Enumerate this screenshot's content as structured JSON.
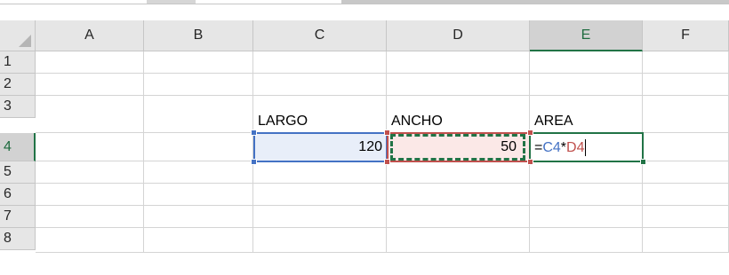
{
  "columns": [
    "A",
    "B",
    "C",
    "D",
    "E",
    "F"
  ],
  "rows": [
    "1",
    "2",
    "3",
    "4",
    "5",
    "6",
    "7",
    "8"
  ],
  "cells": {
    "C3": "LARGO",
    "D3": "ANCHO",
    "E3": "AREA",
    "C4": "120",
    "D4": "50"
  },
  "active_cell": "E4",
  "formula": {
    "prefix": "=",
    "ref1": "C4",
    "operator": "*",
    "ref2": "D4"
  },
  "colors": {
    "ref1": "#4472c4",
    "ref2": "#c0504d",
    "selection": "#217346"
  }
}
